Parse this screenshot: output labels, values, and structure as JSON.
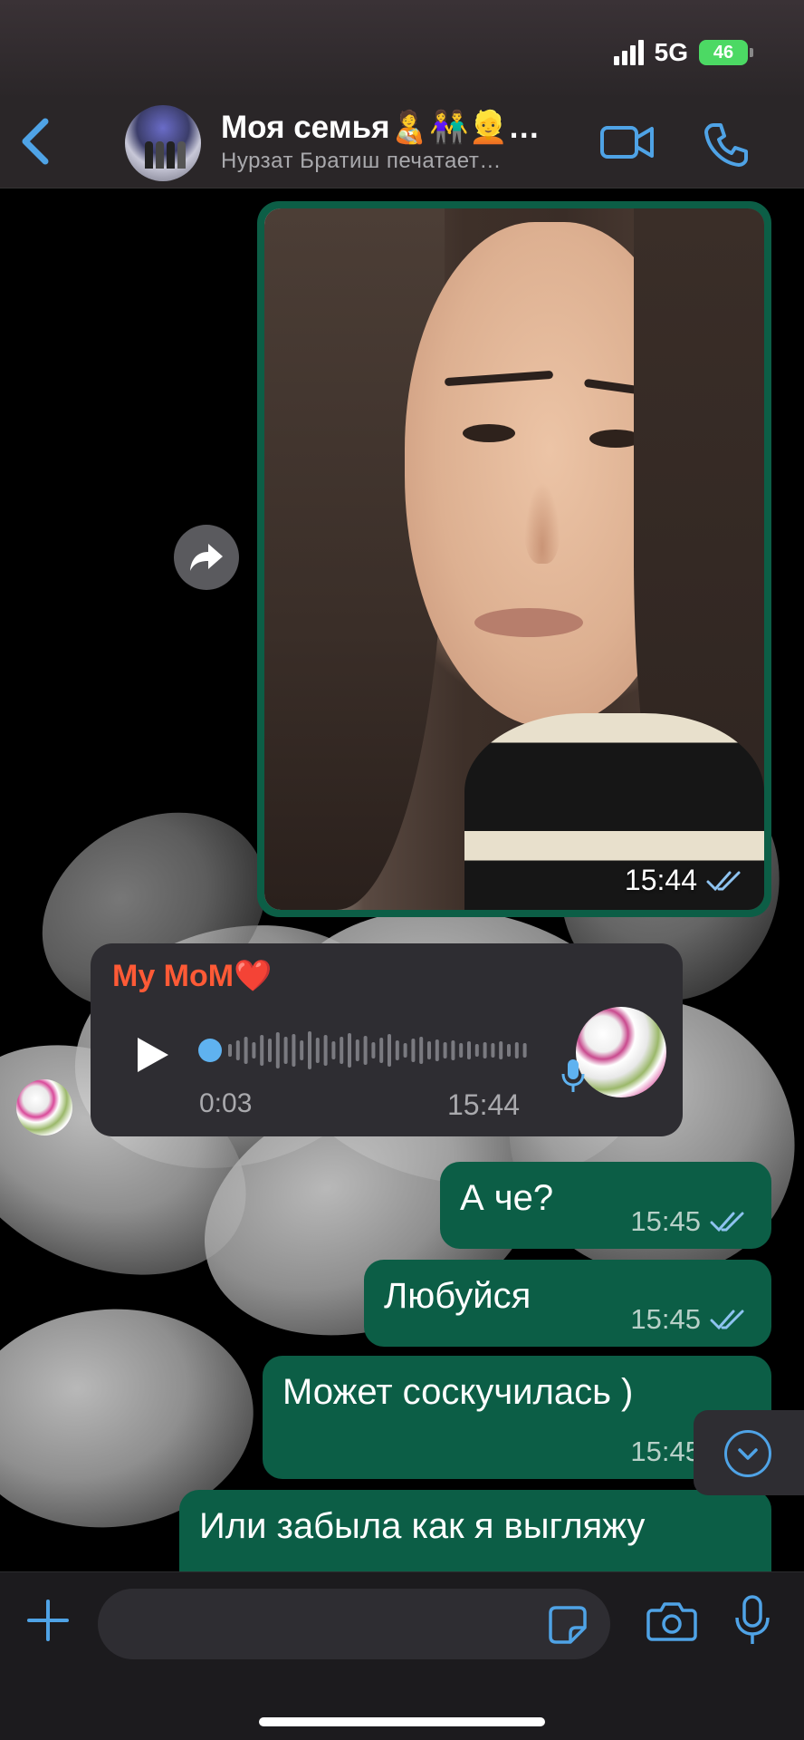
{
  "status_bar": {
    "network": "5G",
    "battery": "46"
  },
  "header": {
    "title": "Моя семья🧑‍🍼👫👱…",
    "subtitle": "Нурзат Братиш печатает…"
  },
  "photo_message": {
    "time": "15:44"
  },
  "voice_message": {
    "sender": "My MoM❤️",
    "duration": "0:03",
    "time": "15:44"
  },
  "messages": [
    {
      "text": "А че?",
      "time": "15:45"
    },
    {
      "text": "Любуйся",
      "time": "15:45"
    },
    {
      "text": "Может соскучилась )",
      "time": "15:45"
    },
    {
      "text": "Или забыла как я выгляжу",
      "time": ""
    }
  ],
  "colors": {
    "outgoing_bubble": "#0c5e46",
    "incoming_bubble": "#2e2d32",
    "accent": "#4fa3e6",
    "sender_name": "#ff5a36"
  },
  "icons": [
    "back-chevron-icon",
    "video-call-icon",
    "phone-icon",
    "forward-icon",
    "play-icon",
    "microphone-icon",
    "double-check-icon",
    "chevron-down-icon",
    "plus-icon",
    "sticker-icon",
    "camera-icon"
  ]
}
